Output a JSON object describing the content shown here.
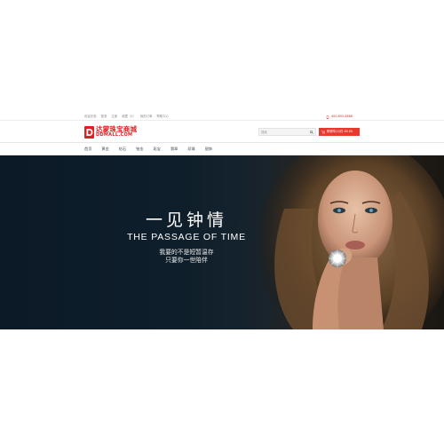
{
  "topbar": {
    "links": [
      "欢迎光临",
      "登录",
      "注册",
      "收藏（0）",
      "我的订单",
      "帮助中心"
    ],
    "phone": "400-655-8888"
  },
  "header": {
    "logo_cn": "达蒙珠宝商城",
    "logo_en": "DDMALL.COM",
    "search_placeholder": "搜索",
    "cart_label": "购物车(0)件 ¥0.00"
  },
  "nav": {
    "items": [
      "首页",
      "黄金",
      "钻石",
      "铂金",
      "彩宝",
      "翡翠",
      "珍珠",
      "银饰"
    ]
  },
  "banner": {
    "title_cn": "一见钟情",
    "title_en": "THE PASSAGE OF TIME",
    "line1": "我要的不是短暂温存",
    "line2": "只要你一世陪伴"
  },
  "colors": {
    "brand_red": "#e02020",
    "cart_red": "#e8392f",
    "banner_dark": "#0b1a26"
  },
  "icons": {
    "phone": "phone-icon",
    "search": "search-icon",
    "cart": "cart-icon",
    "logo": "logo-mark-icon"
  }
}
